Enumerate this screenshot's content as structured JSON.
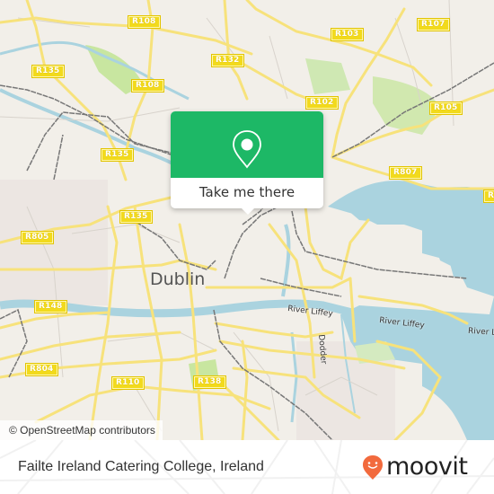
{
  "map": {
    "city_label": "Dublin",
    "road_labels": [
      {
        "id": "r108-top",
        "text": "R108"
      },
      {
        "id": "r103",
        "text": "R103"
      },
      {
        "id": "r107",
        "text": "R107"
      },
      {
        "id": "r135-nw",
        "text": "R135"
      },
      {
        "id": "r132",
        "text": "R132"
      },
      {
        "id": "r108-mid",
        "text": "R108"
      },
      {
        "id": "r102",
        "text": "R102"
      },
      {
        "id": "r105",
        "text": "R105"
      },
      {
        "id": "r135-mid",
        "text": "R135"
      },
      {
        "id": "r807",
        "text": "R807"
      },
      {
        "id": "r135-low",
        "text": "R135"
      },
      {
        "id": "r805",
        "text": "R805"
      },
      {
        "id": "r148",
        "text": "R148"
      },
      {
        "id": "r804",
        "text": "R804"
      },
      {
        "id": "r110",
        "text": "R110"
      },
      {
        "id": "r138",
        "text": "R138"
      },
      {
        "id": "r-edge",
        "text": "R"
      }
    ],
    "water_labels": [
      {
        "id": "liffey-1",
        "text": "River Liffey"
      },
      {
        "id": "liffey-2",
        "text": "River Liffey"
      },
      {
        "id": "liffey-3",
        "text": "River Li"
      },
      {
        "id": "dodder",
        "text": "Dodder"
      }
    ],
    "attribution": "© OpenStreetMap contributors"
  },
  "popup": {
    "icon": "map-pin-icon",
    "cta_label": "Take me there",
    "color": "#1db866"
  },
  "footer": {
    "place_name": "Failte Ireland Catering College, Ireland",
    "logo_text": "moovit",
    "logo_color": "#f26a3d"
  }
}
